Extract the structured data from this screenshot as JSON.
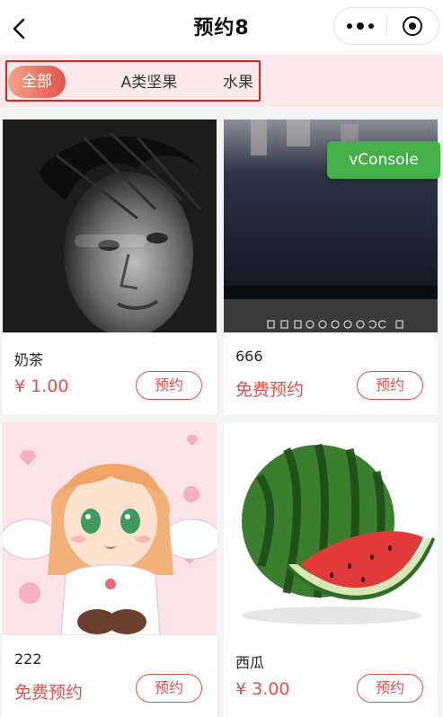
{
  "header": {
    "title": "预约8",
    "back_icon": "chevron-left-icon",
    "more_icon": "more-dots-icon",
    "close_icon": "target-circle-icon"
  },
  "categories": {
    "items": [
      {
        "label": "全部",
        "active": true
      },
      {
        "label": "A类坚果",
        "active": false
      },
      {
        "label": "水果",
        "active": false
      }
    ],
    "active_color_start": "#f2a58a",
    "active_color_end": "#e0524a",
    "outline_color": "#e02323",
    "bar_background": "#fbe9e9"
  },
  "products": [
    {
      "name": "奶茶",
      "price": "¥ 1.00",
      "button": "预约",
      "image": "monochrome-portrait-photo"
    },
    {
      "name": "666",
      "price": "免费预约",
      "button": "预约",
      "image": "dark-image-viewer-photo"
    },
    {
      "name": "222",
      "price": "免费预约",
      "button": "预约",
      "image": "anime-angel-girl-illustration"
    },
    {
      "name": "西瓜",
      "price": "¥ 3.00",
      "button": "预约",
      "image": "watermelon-photo"
    }
  ],
  "vconsole": {
    "label": "vConsole",
    "color": "#43b048"
  },
  "accent_color": "#e0524a"
}
